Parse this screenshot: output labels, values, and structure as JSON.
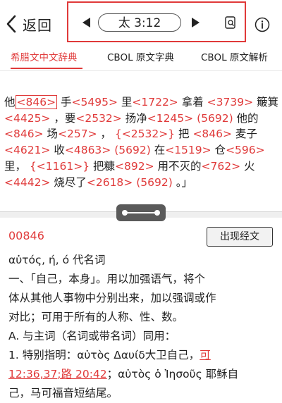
{
  "header": {
    "back_label": "返回",
    "reference": "太 3:12"
  },
  "tabs": [
    {
      "label": "希腊文中文辞典"
    },
    {
      "label": "CBOL 原文字典"
    },
    {
      "label": "CBOL 原文解析"
    }
  ],
  "verse": {
    "l1": {
      "t1": "他",
      "n1": "<846>",
      "t2": " 手",
      "n2": "<5495>",
      "t3": " 里",
      "n3": "<1722>",
      "t4": " 拿着 ",
      "n4": "<3739>",
      "t5": " 簸箕"
    },
    "l2": {
      "n1": "<4425>",
      "t1": " ，要",
      "n2": "<2532>",
      "t2": " 扬净",
      "n3": "<1245>",
      "t3": " ",
      "n4": "(5692)",
      "t4": " 他的"
    },
    "l3": {
      "n1": "<846>",
      "t1": " 场",
      "n2": "<257>",
      "t2": " ， ",
      "n3": "{<2532>}",
      "t3": " 把 ",
      "n4": "<846>",
      "t4": " 麦子"
    },
    "l4": {
      "n1": "<4621>",
      "t1": " 收",
      "n2": "<4863>",
      "t2": " ",
      "n3": "(5692)",
      "t3": " 在",
      "n4": "<1519>",
      "t4": " 仓",
      "n5": "<596>"
    },
    "l5": {
      "t1": "里， ",
      "n1": "{<1161>}",
      "t2": " 把糠",
      "n2": "<892>",
      "t3": " 用不灭的",
      "n3": "<762>",
      "t4": " 火"
    },
    "l6": {
      "n1": "<4442>",
      "t1": " 烧尽了",
      "n2": "<2618>",
      "t2": " ",
      "n3": "(5692)",
      "t3": " 。」"
    }
  },
  "entry": {
    "number": "00846",
    "occurrence_button": "出现经文",
    "lines": {
      "l1": "αὐτός, ή, ό  代名词",
      "l2": "一、「自己，本身」。用以加强语气，将个",
      "l3": "体从其他人事物中分别出来，加以强调或作",
      "l4": "对比；可用于所有的人称、性、数。",
      "l5": "A. 与主词（名词或带名词）同用：",
      "l6a": "1. 特别指明：αὐτὸς Δαυίδ大卫自己，",
      "l6link": "可",
      "l7link1": "12:36,37",
      "l7sep": ";",
      "l7link2": "路 20:42",
      "l7b": "；αὐτὸς ὁ Ἰησοῦς 耶稣自",
      "l8": "己，马可福音短结尾。"
    }
  },
  "colors": {
    "accent": "#e03a3a",
    "text": "#222222"
  }
}
